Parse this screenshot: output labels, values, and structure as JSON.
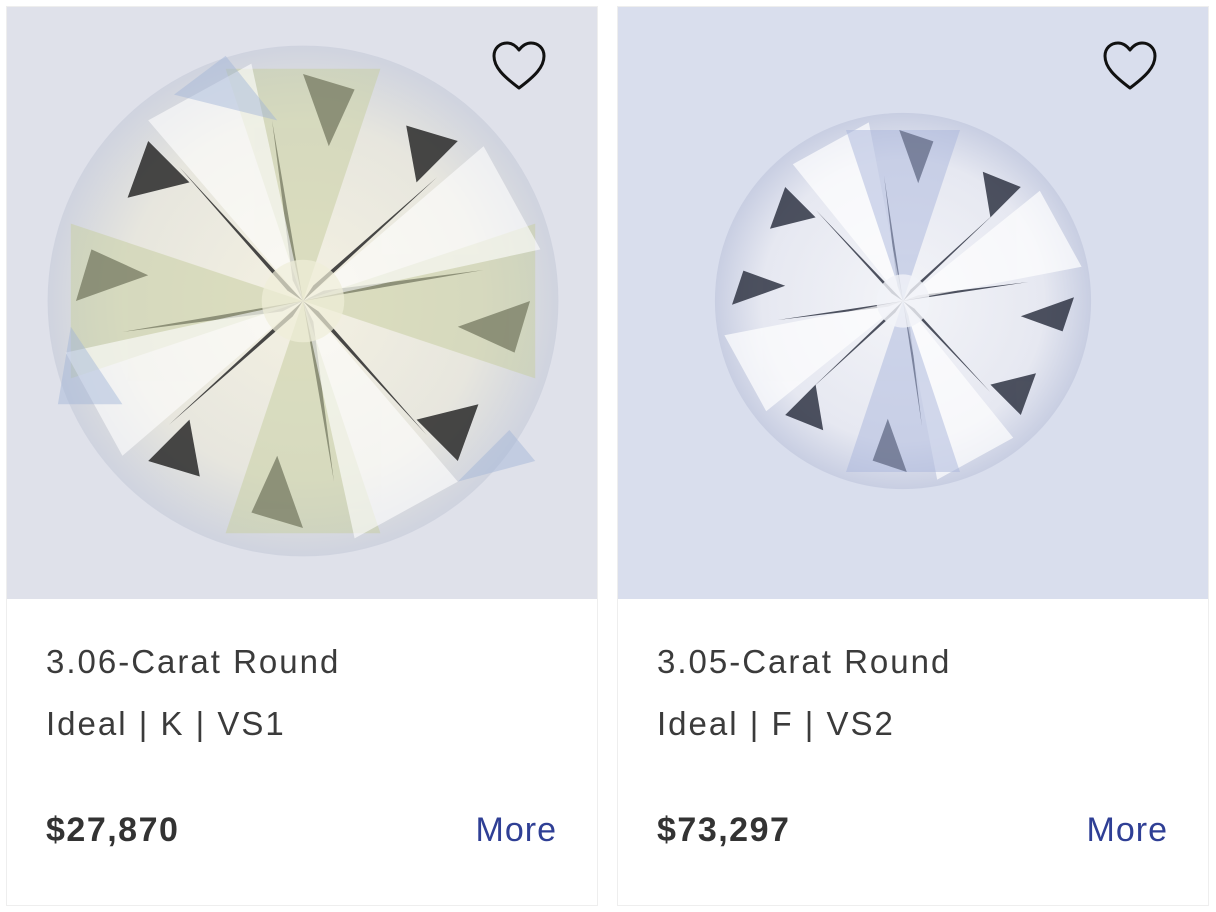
{
  "products": [
    {
      "title": "3.06-Carat Round",
      "specs": "Ideal | K | VS1",
      "price": "$27,870",
      "more_label": "More",
      "favorite_icon": "heart-outline-icon",
      "photo_bg": "#dfe1ea"
    },
    {
      "title": "3.05-Carat Round",
      "specs": "Ideal | F | VS2",
      "price": "$73,297",
      "more_label": "More",
      "favorite_icon": "heart-outline-icon",
      "photo_bg": "#d9deed"
    }
  ],
  "colors": {
    "link": "#2f3f95",
    "text": "#3b3b3b",
    "price": "#333333"
  }
}
